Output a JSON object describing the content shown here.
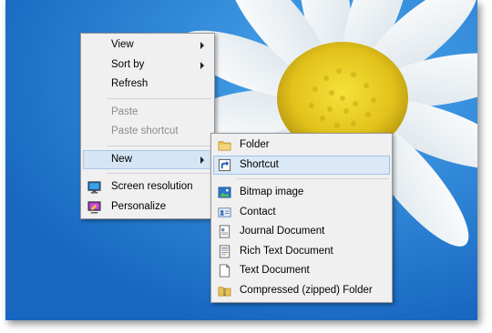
{
  "main_menu": {
    "items": [
      {
        "label": "View",
        "submenu": true
      },
      {
        "label": "Sort by",
        "submenu": true
      },
      {
        "label": "Refresh"
      },
      {
        "label": "Paste",
        "disabled": true
      },
      {
        "label": "Paste shortcut",
        "disabled": true
      },
      {
        "label": "New",
        "submenu": true,
        "open": true
      },
      {
        "label": "Screen resolution",
        "icon": "screen-resolution-icon"
      },
      {
        "label": "Personalize",
        "icon": "personalize-icon"
      }
    ]
  },
  "new_submenu": {
    "items": [
      {
        "label": "Folder",
        "icon": "folder-icon"
      },
      {
        "label": "Shortcut",
        "icon": "shortcut-icon",
        "highlighted": true
      },
      {
        "label": "Bitmap image",
        "icon": "bitmap-image-icon"
      },
      {
        "label": "Contact",
        "icon": "contact-card-icon"
      },
      {
        "label": "Journal Document",
        "icon": "journal-document-icon"
      },
      {
        "label": "Rich Text Document",
        "icon": "rich-text-document-icon"
      },
      {
        "label": "Text Document",
        "icon": "text-document-icon"
      },
      {
        "label": "Compressed (zipped) Folder",
        "icon": "zipped-folder-icon"
      }
    ]
  },
  "colors": {
    "desktop_blue": "#1f7fd6",
    "menu_background": "#f0f0f0",
    "highlight": "#dbe8f6",
    "disabled_text": "#8c8c8c"
  }
}
